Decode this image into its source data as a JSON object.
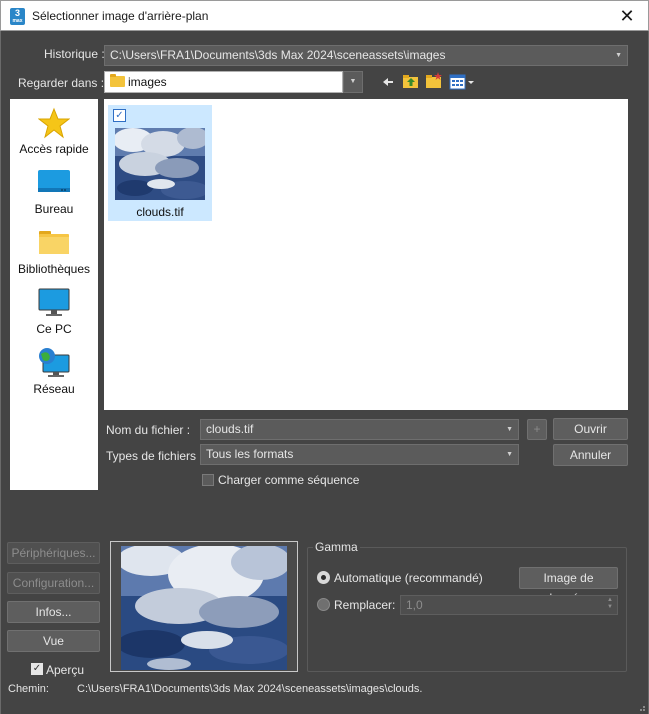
{
  "window": {
    "title": "Sélectionner image d'arrière-plan",
    "app_icon_label": "3",
    "close_icon": "close-icon"
  },
  "history": {
    "label": "Historique :",
    "value": "C:\\Users\\FRA1\\Documents\\3ds Max 2024\\sceneassets\\images"
  },
  "lookin": {
    "label": "Regarder dans :",
    "value": "images",
    "toolbar_icons": [
      "back-arrow-icon",
      "up-folder-icon",
      "new-folder-icon",
      "view-menu-icon"
    ]
  },
  "places": [
    {
      "label": "Accès rapide",
      "icon": "star-icon"
    },
    {
      "label": "Bureau",
      "icon": "desktop-icon"
    },
    {
      "label": "Bibliothèques",
      "icon": "libraries-folder-icon"
    },
    {
      "label": "Ce PC",
      "icon": "monitor-icon"
    },
    {
      "label": "Réseau",
      "icon": "network-icon"
    }
  ],
  "files": [
    {
      "name": "clouds.tif",
      "selected": true,
      "checked": true
    }
  ],
  "filename": {
    "label": "Nom du fichier :",
    "value": "clouds.tif",
    "add_label": "+"
  },
  "filetypes": {
    "label": "Types de fichiers :",
    "value": "Tous les formats"
  },
  "buttons": {
    "open": "Ouvrir",
    "cancel": "Annuler",
    "devices": "Périphériques...",
    "setup": "Configuration...",
    "info": "Infos...",
    "view": "Vue"
  },
  "sequence": {
    "label": "Charger comme séquence",
    "checked": false
  },
  "preview_toggle": {
    "label": "Aperçu",
    "checked": true
  },
  "gamma": {
    "title": "Gamma",
    "automatic_label": "Automatique (recommandé)",
    "data_image_button": "Image de données",
    "override_label": "Remplacer:",
    "override_value": "1,0",
    "selected": "automatic"
  },
  "path": {
    "label": "Chemin:",
    "value": "C:\\Users\\FRA1\\Documents\\3ds Max 2024\\sceneassets\\images\\clouds.tif"
  },
  "colors": {
    "background": "#444444",
    "panel_white": "#ffffff",
    "selection": "#cce8ff",
    "accent_blue": "#2f6fc4",
    "folder_yellow": "#f3c33b"
  }
}
